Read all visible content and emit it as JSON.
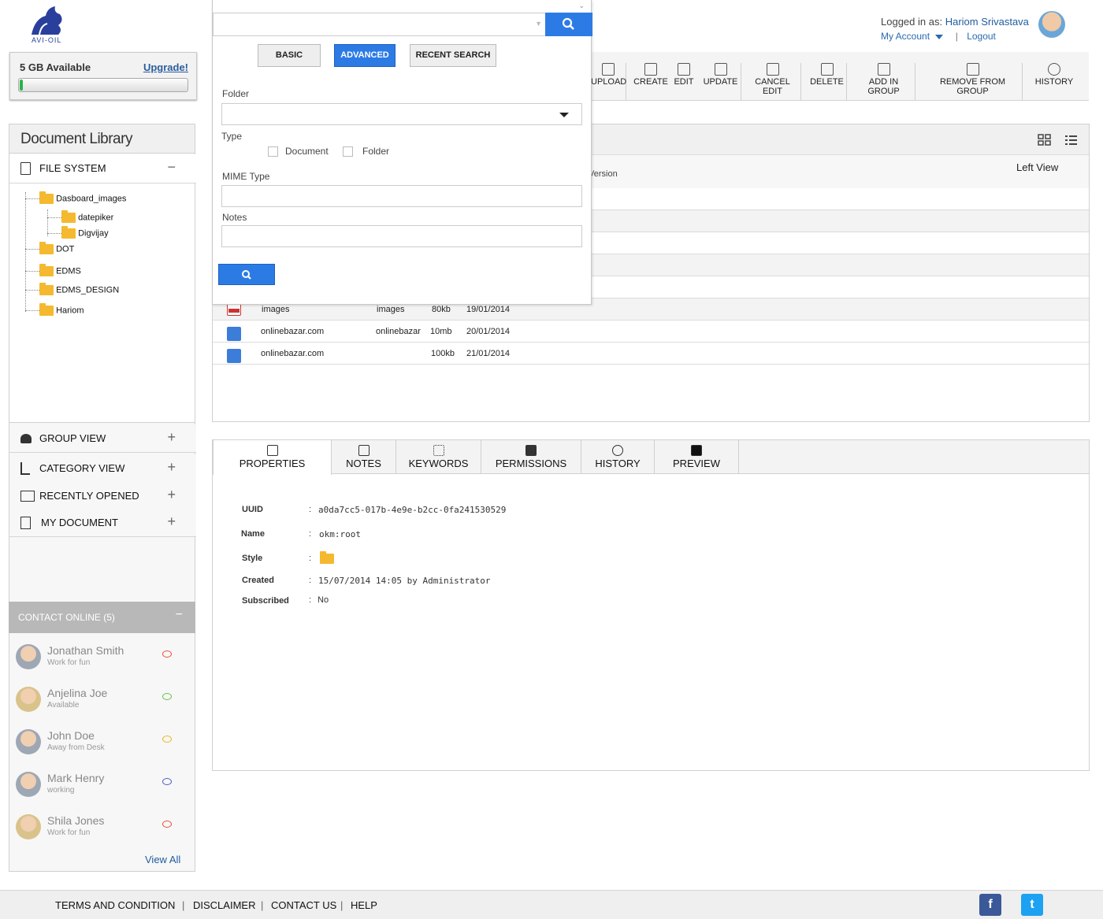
{
  "header": {
    "logo_text": "AVI-OIL",
    "storage": {
      "available": "5 GB Available",
      "upgrade": "Upgrade!",
      "used_fraction": 0.02
    },
    "user": {
      "logged_in_label": "Logged in as:",
      "name": "Hariom Srivastava",
      "my_account": "My Account",
      "separator": "|",
      "logout": "Logout"
    }
  },
  "toolbar": [
    {
      "label": "UPLOAD",
      "icon": "upload-icon"
    },
    {
      "label": "CREATE",
      "icon": "create-icon"
    },
    {
      "label": "EDIT",
      "icon": "edit-icon"
    },
    {
      "label": "UPDATE",
      "icon": "update-icon"
    },
    {
      "label": "CANCEL EDIT",
      "icon": "cancel-edit-icon"
    },
    {
      "label": "DELETE",
      "icon": "trash-icon"
    },
    {
      "label": "ADD IN GROUP",
      "icon": "add-group-icon"
    },
    {
      "label": "REMOVE FROM GROUP",
      "icon": "remove-group-icon"
    },
    {
      "label": "HISTORY",
      "icon": "history-icon"
    }
  ],
  "sidebar": {
    "title": "Document Library",
    "file_system": {
      "label": "FILE SYSTEM",
      "toggle": "−"
    },
    "tree": [
      "Dasboard_images",
      "datepiker",
      "Digvijay",
      "DOT",
      "EDMS",
      "EDMS_DESIGN",
      "Hariom"
    ],
    "sections": [
      {
        "label": "GROUP VIEW",
        "toggle": "+"
      },
      {
        "label": "CATEGORY VIEW",
        "toggle": "+"
      },
      {
        "label": "RECENTLY OPENED",
        "toggle": "+"
      },
      {
        "label": "MY DOCUMENT",
        "toggle": "+"
      }
    ],
    "contact": {
      "title": "CONTACT ONLINE (5)",
      "toggle": "−",
      "people": [
        {
          "name": "Jonathan Smith",
          "status": "Work for fun",
          "color": "#e8533b"
        },
        {
          "name": "Anjelina Joe",
          "status": "Available",
          "color": "#6cc04a"
        },
        {
          "name": "John Doe",
          "status": "Away from Desk",
          "color": "#f0b323"
        },
        {
          "name": "Mark Henry",
          "status": "working",
          "color": "#4a5fc1"
        },
        {
          "name": "Shila Jones",
          "status": "Work for fun",
          "color": "#e8533b"
        }
      ],
      "view_all": "View All"
    }
  },
  "doc_panel": {
    "left_view": "Left View",
    "version_header": "Version"
  },
  "files": [
    {
      "name": "images",
      "author": "images",
      "size": "80kb",
      "date": "19/01/2014",
      "type": "pdf"
    },
    {
      "name": "onlinebazar.com",
      "author": "onlinebazar",
      "size": "10mb",
      "date": "20/01/2014",
      "type": "word"
    },
    {
      "name": "onlinebazar.com",
      "author": "",
      "size": "100kb",
      "date": "21/01/2014",
      "type": "word"
    }
  ],
  "search": {
    "tabs": [
      "BASIC",
      "ADVANCED",
      "RECENT SEARCH"
    ],
    "active_tab": "ADVANCED",
    "folder_label": "Folder",
    "type_label": "Type",
    "type_options": [
      "Document",
      "Folder"
    ],
    "mime_label": "MIME Type",
    "notes_label": "Notes"
  },
  "properties": {
    "tabs": [
      {
        "label": "PROPERTIES",
        "icon": "properties-icon"
      },
      {
        "label": "NOTES",
        "icon": "notes-icon"
      },
      {
        "label": "KEYWORDS",
        "icon": "keywords-icon"
      },
      {
        "label": "PERMISSIONS",
        "icon": "permissions-icon"
      },
      {
        "label": "HISTORY",
        "icon": "history-icon"
      },
      {
        "label": "PREVIEW",
        "icon": "preview-icon"
      }
    ],
    "fields": [
      {
        "key": "UUID",
        "value": "a0da7cc5-017b-4e9e-b2cc-0fa241530529"
      },
      {
        "key": "Name",
        "value": "okm:root"
      },
      {
        "key": "Style",
        "value": ""
      },
      {
        "key": "Created",
        "value": "15/07/2014  14:05 by Administrator"
      },
      {
        "key": "Subscribed",
        "value": "No"
      }
    ],
    "colon": ":"
  },
  "footer": {
    "links": [
      "TERMS AND CONDITION",
      "DISCLAIMER",
      "CONTACT US",
      "HELP"
    ],
    "pipe": "|",
    "facebook": "f",
    "twitter": "t"
  },
  "colors": {
    "accent": "#2c7be5",
    "link": "#1f5c9e",
    "folder": "#f5b930"
  }
}
